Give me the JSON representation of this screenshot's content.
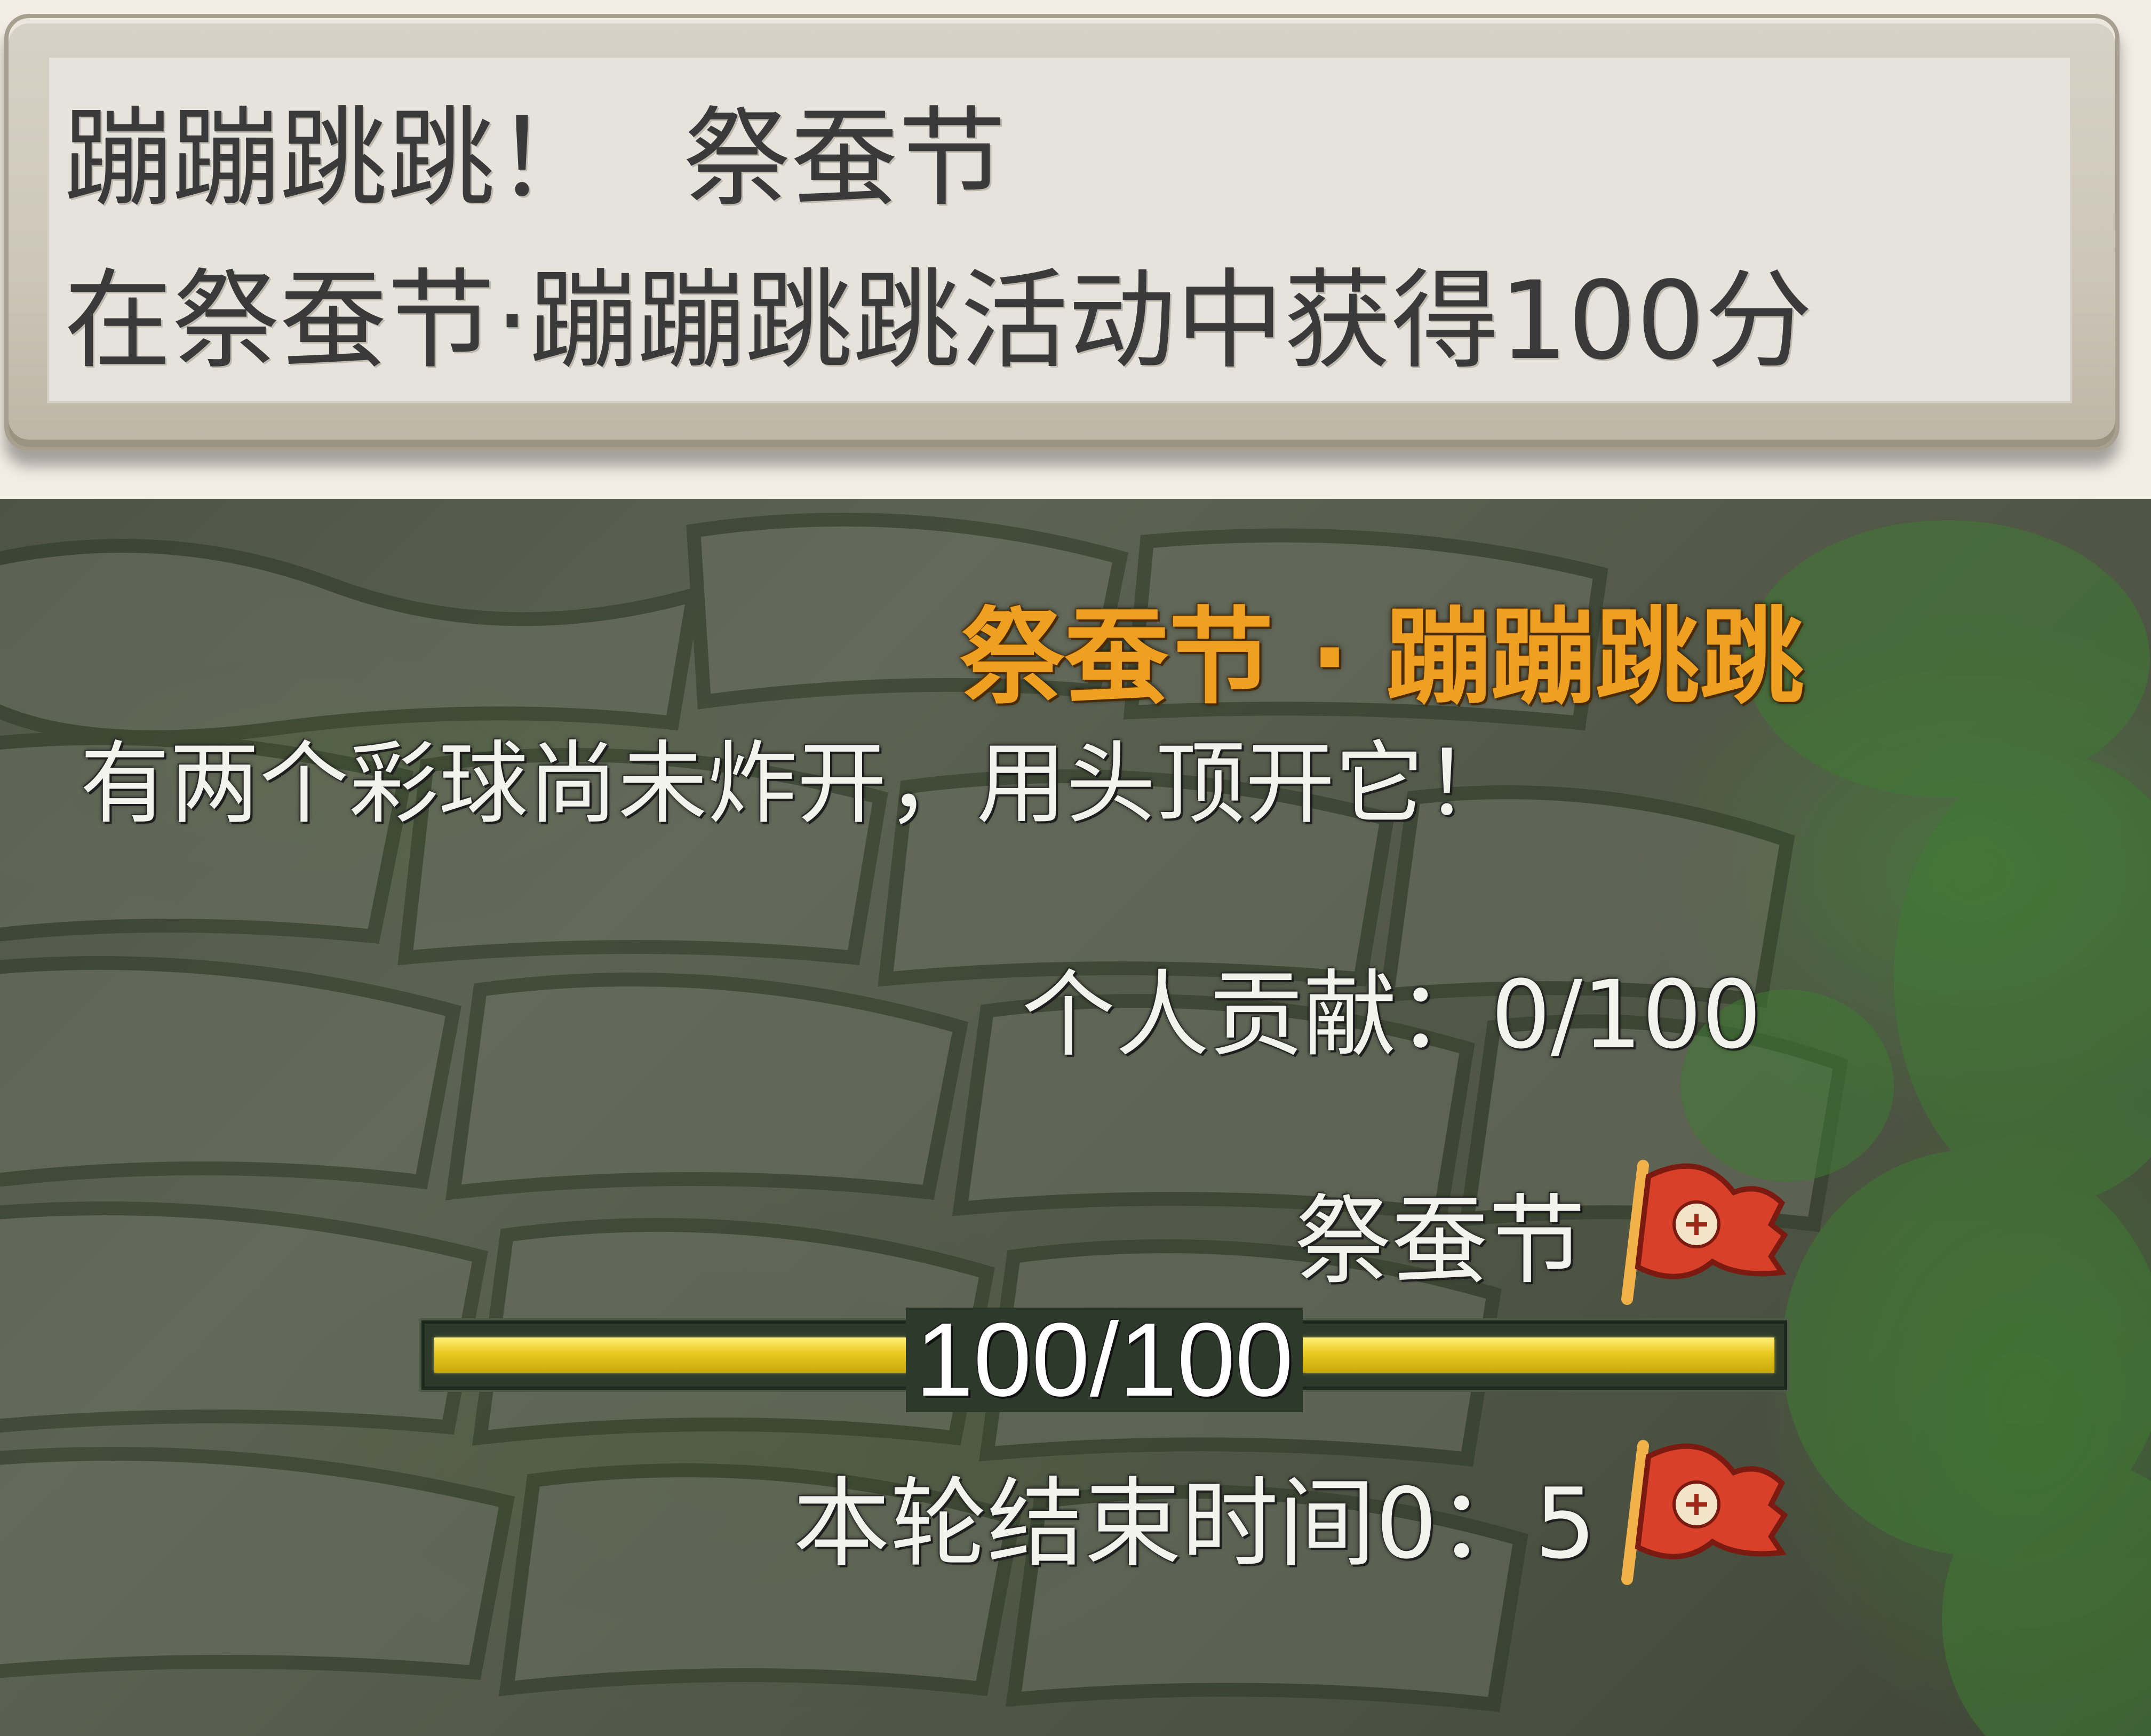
{
  "tooltip": {
    "title_main": "蹦蹦跳跳！",
    "title_event": "祭蚕节",
    "description": "在祭蚕节·蹦蹦跳跳活动中获得100分"
  },
  "hud": {
    "event_title": "祭蚕节 · 蹦蹦跳跳",
    "message": "有两个彩球尚未炸开，用头顶开它！",
    "contribution": "个人贡献：0/100",
    "festival_label": "祭蚕节",
    "progress": {
      "text": "100/100",
      "current": 100,
      "max": 100
    },
    "round_end_time": "本轮结束时间0：5",
    "flag_icon": "red-banner-icon"
  },
  "colors": {
    "event_title": "#f0a020",
    "progress_fill": "#e8c920",
    "flag": "#d8402a"
  }
}
